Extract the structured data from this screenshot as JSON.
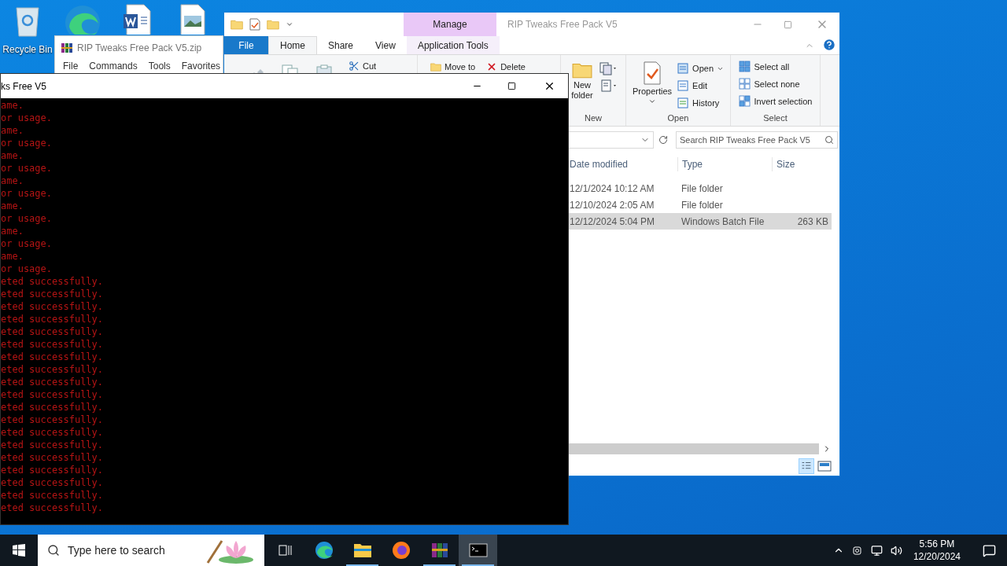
{
  "desktop_icons": [
    {
      "kind": "recycle",
      "label": "Recycle Bin"
    },
    {
      "kind": "edge"
    },
    {
      "kind": "word"
    },
    {
      "kind": "image"
    }
  ],
  "winrar": {
    "title": "RIP Tweaks Free Pack V5.zip",
    "menu": [
      "File",
      "Commands",
      "Tools",
      "Favorites"
    ]
  },
  "explorer": {
    "context_tab": "Manage",
    "title": "RIP Tweaks Free Pack V5",
    "tabs": [
      {
        "label": "File",
        "kind": "file",
        "selected": false
      },
      {
        "label": "Home",
        "kind": "tab",
        "selected": true
      },
      {
        "label": "Share",
        "kind": "tab",
        "selected": false
      },
      {
        "label": "View",
        "kind": "tab",
        "selected": false
      },
      {
        "label": "Application Tools",
        "kind": "context",
        "selected": false
      }
    ],
    "clipboard": {
      "cut": "Cut"
    },
    "organize": {
      "move_to": "Move to",
      "delete": "Delete"
    },
    "groups": [
      {
        "label": "New",
        "kind": "new",
        "items": [
          "New folder"
        ]
      },
      {
        "label": "Open",
        "kind": "open",
        "items": [
          "Properties",
          "Open",
          "Edit",
          "History"
        ]
      },
      {
        "label": "Select",
        "kind": "select",
        "items": [
          "Select all",
          "Select none",
          "Invert selection"
        ]
      }
    ],
    "search": {
      "placeholder": "Search RIP Tweaks Free Pack V5"
    },
    "columns": [
      "Date modified",
      "Type",
      "Size"
    ],
    "rows": [
      {
        "date": "12/1/2024 10:12 AM",
        "type": "File folder",
        "selected": false
      },
      {
        "date": "12/10/2024 2:05 AM",
        "type": "File folder",
        "selected": false
      },
      {
        "date": "12/12/2024 5:04 PM",
        "type": "Windows Batch File",
        "size": "263 KB",
        "selected": true
      }
    ]
  },
  "console": {
    "title": "ks Free V5",
    "lines": [
      "ame.",
      "or usage.",
      "ame.",
      "or usage.",
      "ame.",
      "or usage.",
      "ame.",
      "or usage.",
      "ame.",
      "or usage.",
      "ame.",
      "or usage.",
      "ame.",
      "or usage.",
      "eted successfully.",
      "eted successfully.",
      "eted successfully.",
      "eted successfully.",
      "eted successfully.",
      "eted successfully.",
      "eted successfully.",
      "eted successfully.",
      "eted successfully.",
      "eted successfully.",
      "eted successfully.",
      "eted successfully.",
      "eted successfully.",
      "eted successfully.",
      "eted successfully.",
      "eted successfully.",
      "eted successfully.",
      "eted successfully.",
      "eted successfully."
    ]
  },
  "taskbar": {
    "search_placeholder": "Type here to search",
    "apps": [
      {
        "kind": "taskview",
        "running": false,
        "selected": false
      },
      {
        "kind": "edge",
        "running": false,
        "selected": false
      },
      {
        "kind": "explorer",
        "running": true,
        "selected": false
      },
      {
        "kind": "firefox",
        "running": false,
        "selected": false
      },
      {
        "kind": "winrar",
        "running": true,
        "selected": false
      },
      {
        "kind": "console",
        "running": true,
        "selected": true
      }
    ],
    "time": "5:56 PM",
    "date": "12/20/2024"
  }
}
